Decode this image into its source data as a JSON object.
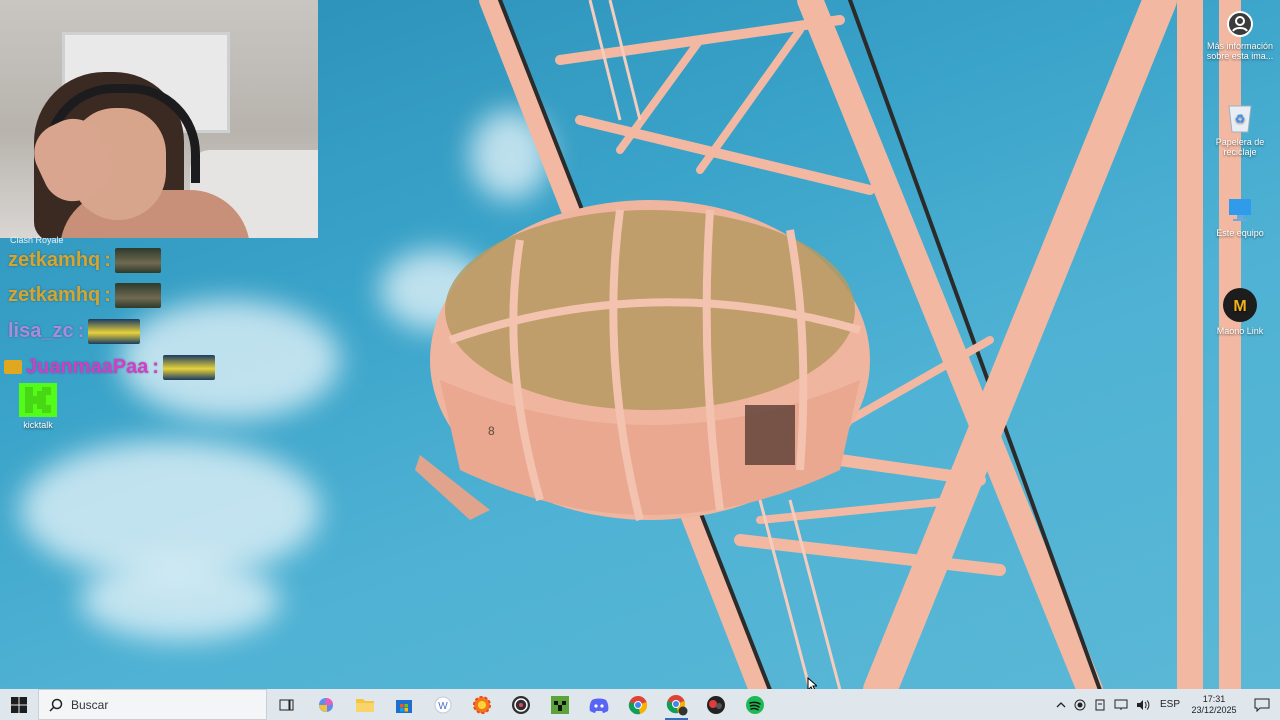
{
  "webcam": {
    "label": "Clash Royale"
  },
  "chat": [
    {
      "user": "zetkamhq",
      "sep": ":",
      "color": "#d4a530"
    },
    {
      "user": "zetkamhq",
      "sep": ":",
      "color": "#d4a530"
    },
    {
      "user": "lisa_zc",
      "sep": ":",
      "color": "#a98be0"
    },
    {
      "user": "JuanmaaPaa",
      "sep": ":",
      "color": "#d23ec9"
    }
  ],
  "desktop_icons": {
    "kicktalk": "kicktalk",
    "more_info": "Más información sobre esta ima...",
    "recycle": "Papelera de reciclaje",
    "this_pc": "Este equipo",
    "maono": "Maono Link"
  },
  "taskbar": {
    "search_placeholder": "Buscar",
    "apps": [
      "task-view",
      "copilot",
      "file-explorer",
      "microsoft-store",
      "wps",
      "browser-orange",
      "obs",
      "minecraft",
      "discord",
      "chrome",
      "chrome-profile",
      "bluestacks",
      "spotify"
    ],
    "language": "ESP",
    "time": "17:31",
    "date": "23/12/2025"
  },
  "colors": {
    "sky": "#3aa3c9",
    "taskbar": "#dfe6ec",
    "wheel": "#f4b9a4",
    "kick_green": "#53fc18"
  }
}
